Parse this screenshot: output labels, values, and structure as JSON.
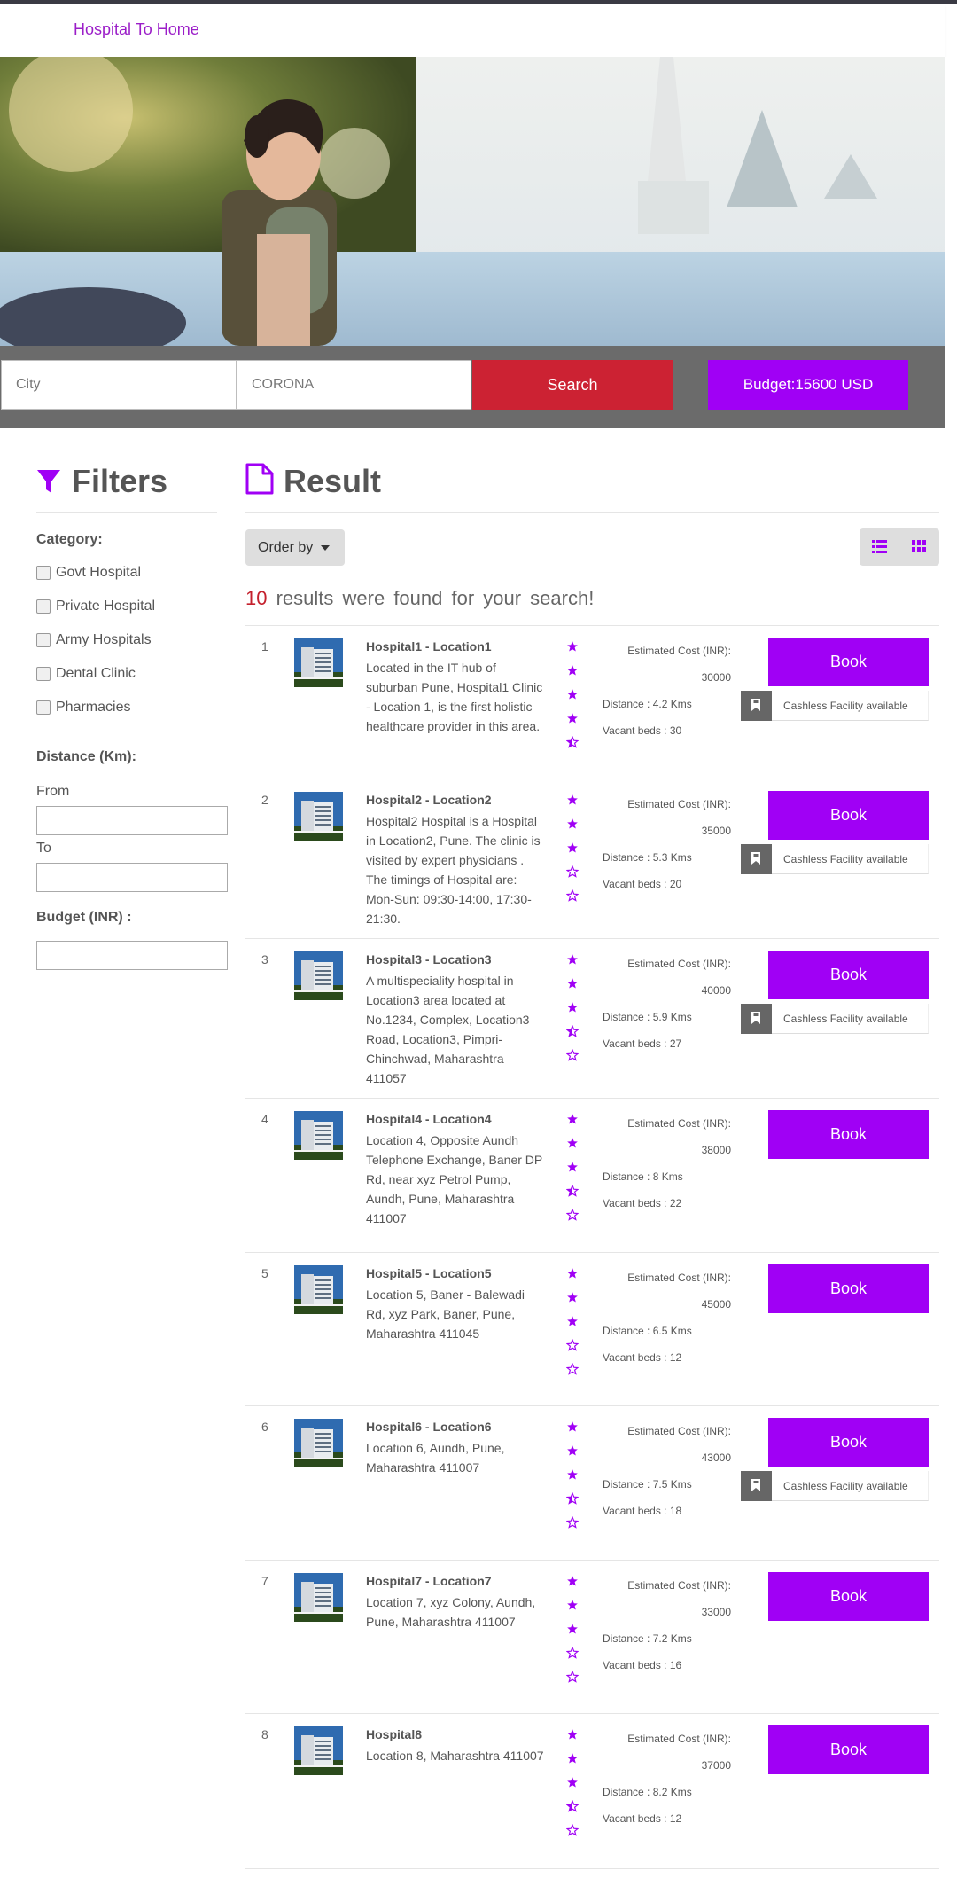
{
  "brand": "Hospital To Home",
  "search": {
    "city_placeholder": "City",
    "query_value": "CORONA",
    "search_label": "Search",
    "budget_label": "Budget:15600 USD"
  },
  "filters": {
    "title": "Filters",
    "category_label": "Category:",
    "categories": [
      "Govt Hospital",
      "Private Hospital",
      "Army Hospitals",
      "Dental Clinic",
      "Pharmacies"
    ],
    "distance_label": "Distance  (Km):",
    "from_label": "From",
    "to_label": "To",
    "budget_label": "Budget  (INR)  :"
  },
  "results": {
    "title": "Result",
    "order_by": "Order by",
    "count": "10",
    "summary_text": "results were found for your search!",
    "cost_label": "Estimated Cost (INR):",
    "book_label": "Book",
    "cashless_label": "Cashless Facility available",
    "items": [
      {
        "index": "1",
        "name": "Hospital1 - Location1",
        "desc": "Located in the IT hub of suburban Pune, Hospital1 Clinic - Location 1, is the first holistic healthcare provider in this area.",
        "rating": 4.5,
        "cost": "30000",
        "distance": "Distance : 4.2 Kms",
        "beds": "Vacant beds : 30",
        "cashless": true
      },
      {
        "index": "2",
        "name": "Hospital2 - Location2",
        "desc": "Hospital2 Hospital is a Hospital in Location2, Pune. The clinic is visited by expert physicians . The timings of Hospital are: Mon-Sun: 09:30-14:00, 17:30-21:30.",
        "rating": 3,
        "cost": "35000",
        "distance": "Distance : 5.3 Kms",
        "beds": "Vacant beds : 20",
        "cashless": true
      },
      {
        "index": "3",
        "name": "Hospital3 - Location3",
        "desc": "A multispeciality hospital in Location3 area located at No.1234, Complex, Location3 Road, Location3, Pimpri-Chinchwad, Maharashtra 411057",
        "rating": 3.5,
        "cost": "40000",
        "distance": "Distance : 5.9 Kms",
        "beds": "Vacant beds : 27",
        "cashless": true
      },
      {
        "index": "4",
        "name": "Hospital4 - Location4",
        "desc": "Location 4, Opposite Aundh Telephone Exchange, Baner DP Rd, near xyz Petrol Pump, Aundh, Pune, Maharashtra 411007",
        "rating": 3.5,
        "cost": "38000",
        "distance": "Distance : 8 Kms",
        "beds": "Vacant beds : 22",
        "cashless": false
      },
      {
        "index": "5",
        "name": "Hospital5 - Location5",
        "desc": "Location 5, Baner - Balewadi Rd, xyz Park, Baner, Pune, Maharashtra 411045",
        "rating": 3,
        "cost": "45000",
        "distance": "Distance : 6.5 Kms",
        "beds": "Vacant beds : 12",
        "cashless": false
      },
      {
        "index": "6",
        "name": "Hospital6 - Location6",
        "desc": "Location 6, Aundh, Pune, Maharashtra 411007",
        "rating": 3.5,
        "cost": "43000",
        "distance": "Distance : 7.5 Kms",
        "beds": "Vacant beds : 18",
        "cashless": true
      },
      {
        "index": "7",
        "name": "Hospital7 - Location7",
        "desc": "Location 7, xyz Colony, Aundh, Pune, Maharashtra 411007",
        "rating": 3,
        "cost": "33000",
        "distance": "Distance : 7.2 Kms",
        "beds": "Vacant beds : 16",
        "cashless": false
      },
      {
        "index": "8",
        "name": "Hospital8",
        "desc": "Location 8, Maharashtra 411007",
        "rating": 3.5,
        "cost": "37000",
        "distance": "Distance : 8.2 Kms",
        "beds": "Vacant beds : 12",
        "cashless": false
      }
    ]
  },
  "colors": {
    "accent": "#a000f5",
    "brand_text": "#9b1ec8",
    "search_button": "#cc2233",
    "count_red": "#c4212d"
  }
}
